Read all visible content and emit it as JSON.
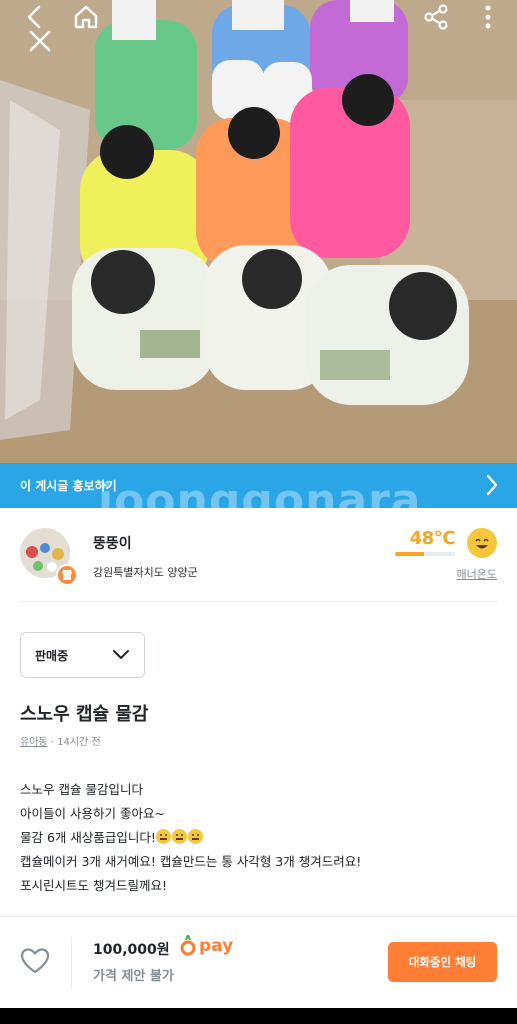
{
  "topbar": {
    "back_icon": "chevron-left-icon",
    "home_icon": "home-icon",
    "close_icon": "close-icon",
    "share_icon": "share-icon",
    "more_icon": "more-vertical-icon"
  },
  "promo": {
    "label": "이 게시글 홍보하기",
    "watermark": "joonggonara"
  },
  "seller": {
    "name": "뚱뚱이",
    "location": "강원특별자치도 양양군",
    "temperature": "48℃",
    "temperature_fraction": 0.48,
    "temperature_label": "매너온도"
  },
  "status": {
    "selected": "판매중"
  },
  "listing": {
    "title": "스노우 캡슐 물감",
    "category": "유아동",
    "time": "14시간 전",
    "desc_line1": "스노우 캡슐 물감입니다",
    "desc_line2": "아이들이 사용하기 좋아요~",
    "desc_line3": "물감 6개 새상품급입니다!",
    "desc_line4": "캡슐메이커 3개 새거예요! 캡슐만드는 통 사각형 3개 챙겨드려요!",
    "desc_line5": "포시린시트도 챙겨드릴께요!"
  },
  "bottom": {
    "price": "100,000원",
    "pay_label": "pay",
    "negotiation": "가격 제안 불가",
    "chat_button": "대화중인 채팅"
  },
  "colors": {
    "accent": "#ff7e36",
    "promo_blue": "#2aa6e6",
    "temperature": "#f5a623"
  }
}
